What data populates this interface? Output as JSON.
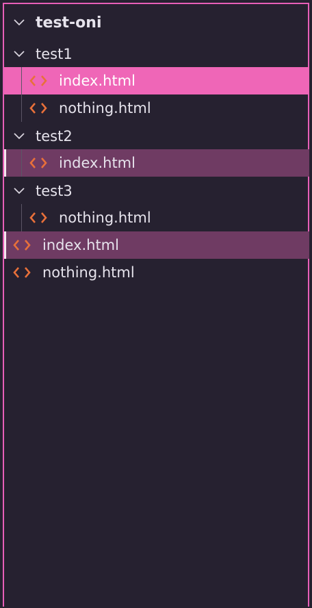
{
  "root": {
    "label": "test-oni"
  },
  "tree": {
    "test1": {
      "label": "test1",
      "files": [
        "index.html",
        "nothing.html"
      ]
    },
    "test2": {
      "label": "test2",
      "files": [
        "index.html"
      ]
    },
    "test3": {
      "label": "test3",
      "files": [
        "nothing.html"
      ]
    },
    "root_files": [
      "index.html",
      "nothing.html"
    ]
  },
  "colors": {
    "background": "#262130",
    "border": "#e85fb8",
    "selected": "#ef66b7",
    "open_file": "#6f3b63",
    "file_icon": "#e8703a"
  },
  "icons": {
    "folder_toggle": "chevron-down-icon",
    "file": "code-brackets-icon"
  }
}
